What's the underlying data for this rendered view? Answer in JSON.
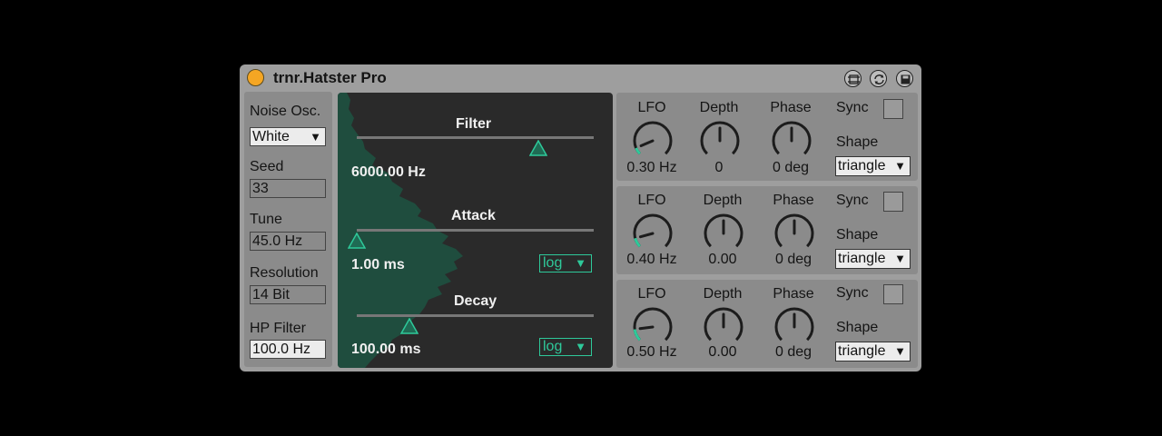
{
  "device": {
    "title": "trnr.Hatster Pro",
    "title_icons": [
      "grip-icon",
      "hot-swap-icon",
      "save-preset-icon"
    ]
  },
  "left_panel": {
    "noise_osc": {
      "label": "Noise Osc.",
      "value": "White"
    },
    "seed": {
      "label": "Seed",
      "value": "33"
    },
    "tune": {
      "label": "Tune",
      "value": "45.0 Hz"
    },
    "resolution": {
      "label": "Resolution",
      "value": "14 Bit"
    },
    "hp_filter": {
      "label": "HP Filter",
      "value": "100.0 Hz"
    }
  },
  "envelope": {
    "filter": {
      "label": "Filter",
      "value": "6000.00 Hz",
      "position": 0.77
    },
    "attack": {
      "label": "Attack",
      "value": "1.00 ms",
      "position": 0.0,
      "mode": "log"
    },
    "decay": {
      "label": "Decay",
      "value": "100.00 ms",
      "position": 0.22,
      "mode": "log"
    }
  },
  "lfos": [
    {
      "lfo_label": "LFO",
      "lfo_value": "0.30 Hz",
      "lfo_knob": 0.08,
      "depth_label": "Depth",
      "depth_value": "0",
      "depth_knob": 0.5,
      "phase_label": "Phase",
      "phase_value": "0 deg",
      "phase_knob": 0.5,
      "sync_label": "Sync",
      "shape_label": "Shape",
      "shape_value": "triangle"
    },
    {
      "lfo_label": "LFO",
      "lfo_value": "0.40 Hz",
      "lfo_knob": 0.11,
      "depth_label": "Depth",
      "depth_value": "0.00",
      "depth_knob": 0.5,
      "phase_label": "Phase",
      "phase_value": "0 deg",
      "phase_knob": 0.5,
      "sync_label": "Sync",
      "shape_label": "Shape",
      "shape_value": "triangle"
    },
    {
      "lfo_label": "LFO",
      "lfo_value": "0.50 Hz",
      "lfo_knob": 0.14,
      "depth_label": "Depth",
      "depth_value": "0.00",
      "depth_knob": 0.5,
      "phase_label": "Phase",
      "phase_value": "0 deg",
      "phase_knob": 0.5,
      "sync_label": "Sync",
      "shape_label": "Shape",
      "shape_value": "triangle"
    }
  ],
  "colors": {
    "accent": "#2ec99a",
    "power": "#f5a623",
    "display_bg": "#2a2a2a",
    "wave": "#1f4d3e"
  }
}
